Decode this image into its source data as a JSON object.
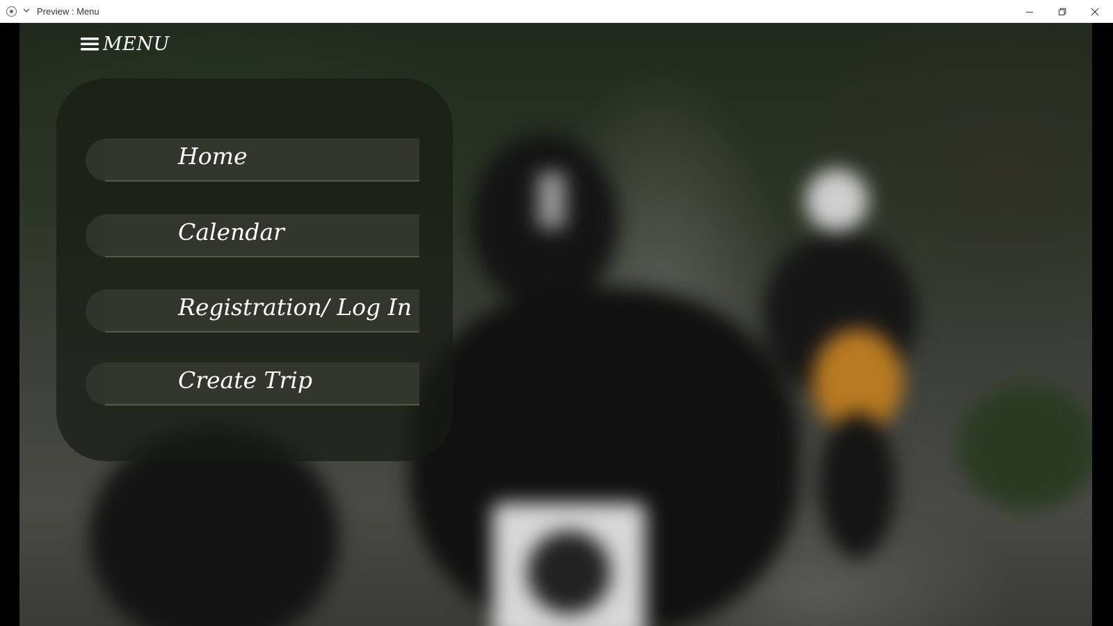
{
  "window": {
    "title": "Preview : Menu",
    "icons": [
      "app-icon",
      "chevron-down-icon",
      "minimize-icon",
      "maximize-icon",
      "close-icon"
    ]
  },
  "menu": {
    "title": "MENU",
    "icon": "hamburger-icon",
    "items": [
      {
        "label": "Home"
      },
      {
        "label": "Calendar"
      },
      {
        "label": "Registration/ Log In"
      },
      {
        "label": "Create Trip"
      }
    ]
  },
  "colors": {
    "panel": "#181c14",
    "button": "#32362d",
    "text": "#ffffff"
  }
}
